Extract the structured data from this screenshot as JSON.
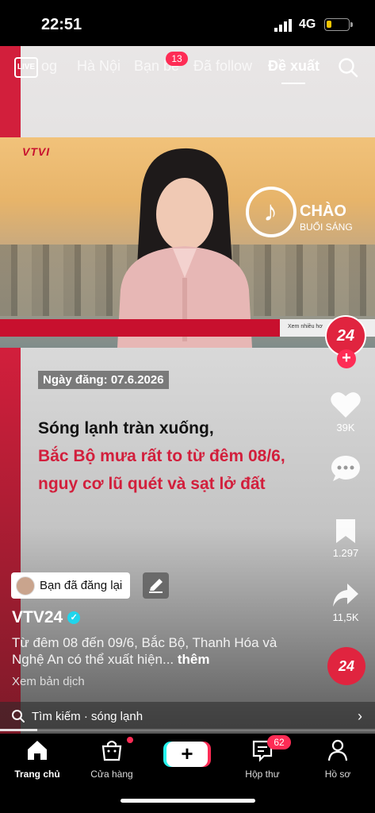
{
  "status": {
    "time": "22:51",
    "network": "4G"
  },
  "top_tabs": {
    "live_label": "LIVE",
    "tabs": [
      "og",
      "Hà Nội",
      "Bạn bè",
      "Đã follow",
      "Đề xuất"
    ],
    "friends_badge": "13"
  },
  "video": {
    "channel_logo": "VTVI",
    "show_title": "CHÀO",
    "show_subtitle": "BUỔI SÁNG",
    "ticker": "Xem nhiều hơ",
    "date_tag": "Ngày đăng: 07.6.2026",
    "headline": [
      "Sóng lạnh tràn xuống,",
      "Bắc Bộ mưa rất to từ đêm 08/6,",
      "nguy cơ lũ quét và sạt lở đất"
    ]
  },
  "actions": {
    "creator_avatar": "24",
    "likes": "39K",
    "saves": "1.297",
    "shares": "11,5K",
    "sound_disc": "24"
  },
  "post": {
    "reposted_label": "Bạn đã đăng lại",
    "author": "VTV24",
    "description": "Từ đêm 08 đến 09/6, Bắc Bộ, Thanh Hóa và Nghệ An có thể xuất hiện...",
    "more": "thêm",
    "translate": "Xem bản dịch"
  },
  "search_bar": {
    "text": "Tìm kiếm · sóng lạnh"
  },
  "progress": 0.1,
  "bottom_nav": {
    "home": "Trang chủ",
    "shop": "Cửa hàng",
    "inbox": "Hộp thư",
    "inbox_badge": "62",
    "profile": "Hồ sơ"
  },
  "colors": {
    "accent": "#fe2c55",
    "vtv_red": "#d21f3c",
    "verified": "#20d5ec"
  }
}
